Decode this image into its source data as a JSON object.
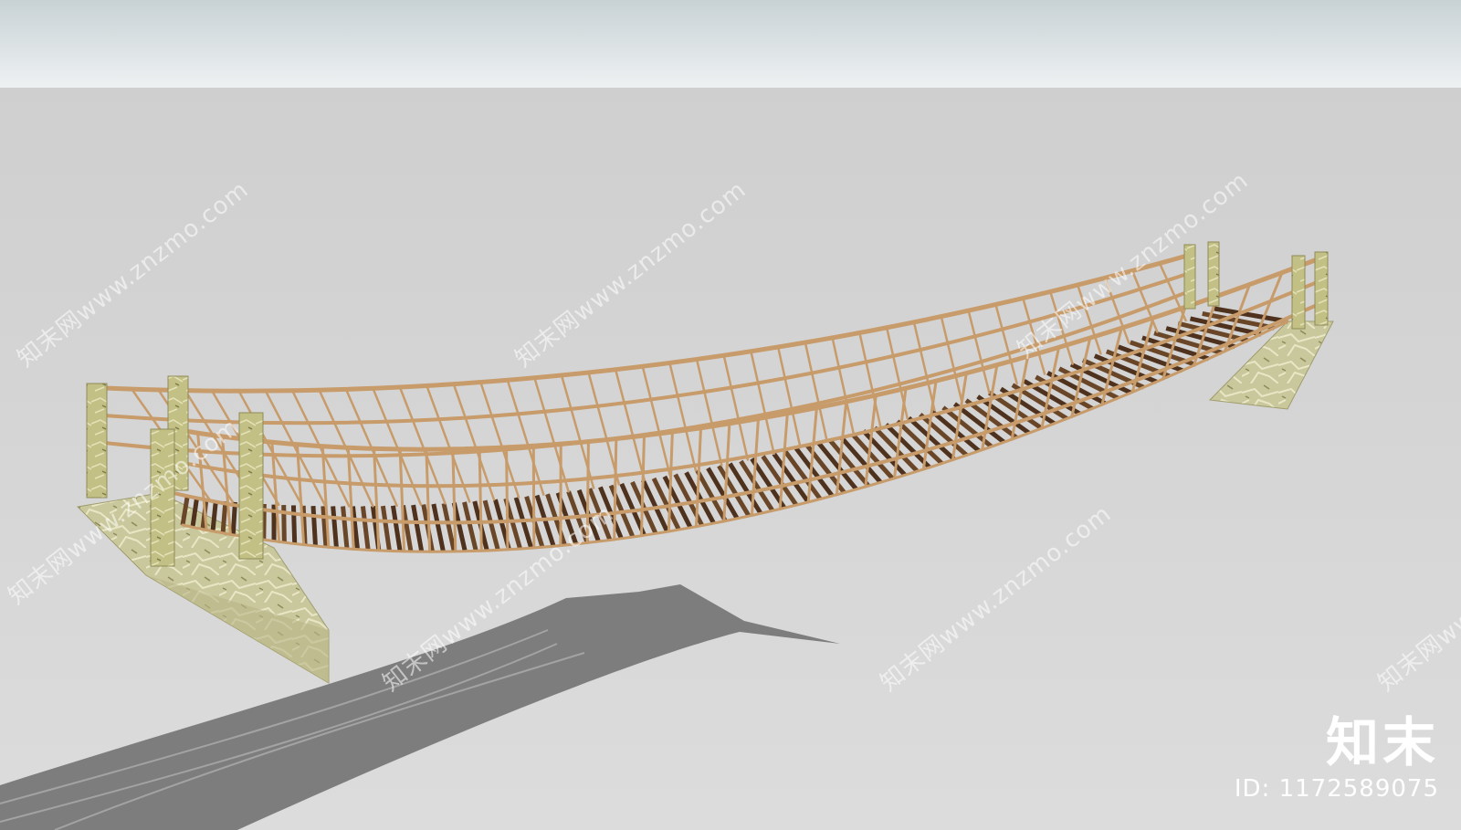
{
  "scene": {
    "subject": "rope suspension bridge with wooden planks and stone abutments",
    "colors": {
      "sky_top": "#c9d3d6",
      "sky_bottom": "#eef1f2",
      "ground": "#d6d6d6",
      "shadow": "#7a7a7a",
      "rope": "#c79b6a",
      "plank": "#5a3a22",
      "stone": "#c9c79a",
      "post": "#c2bf84"
    }
  },
  "watermarks": {
    "text": "知末网www.znzmo.com"
  },
  "logo": {
    "mark": "知末",
    "id_label": "ID: 1172589075"
  }
}
